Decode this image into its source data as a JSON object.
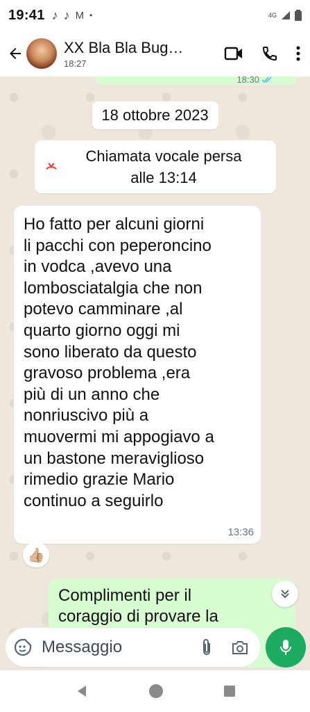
{
  "status_bar": {
    "time": "19:41",
    "network": "4G"
  },
  "header": {
    "contact_name": "XX Bla Bla Bug…",
    "contact_subtitle": "18:27"
  },
  "chat": {
    "previous_time": "18:30",
    "date_chip": "18 ottobre 2023",
    "missed_call": {
      "text": "Chiamata vocale persa\nalle 13:14"
    },
    "incoming_message": {
      "text": "Ho fatto  per alcuni giorni\nli pacchi con peperoncino\nin vodca ,avevo una\nlombosciatalgia che non\npotevo camminare ,al\nquarto giorno oggi mi\nsono liberato da questo\ngravoso problema ,era\npiù di un anno che\nnonriuscivo  più a\nmuovermi mi appogiavo a\nun bastone  meraviglioso\nrimedio grazie  Mario\ncontinuo a seguirlo",
      "time": "13:36",
      "reaction": "👍🏼"
    },
    "outgoing_message": {
      "text": "Complimenti per il\ncoraggio di provare la"
    }
  },
  "composer": {
    "placeholder": "Messaggio"
  },
  "colors": {
    "outgoing_bubble": "#d9fdd3",
    "mic_button": "#1daa61",
    "missed_call_red": "#e53935",
    "read_ticks": "#53bdeb"
  }
}
